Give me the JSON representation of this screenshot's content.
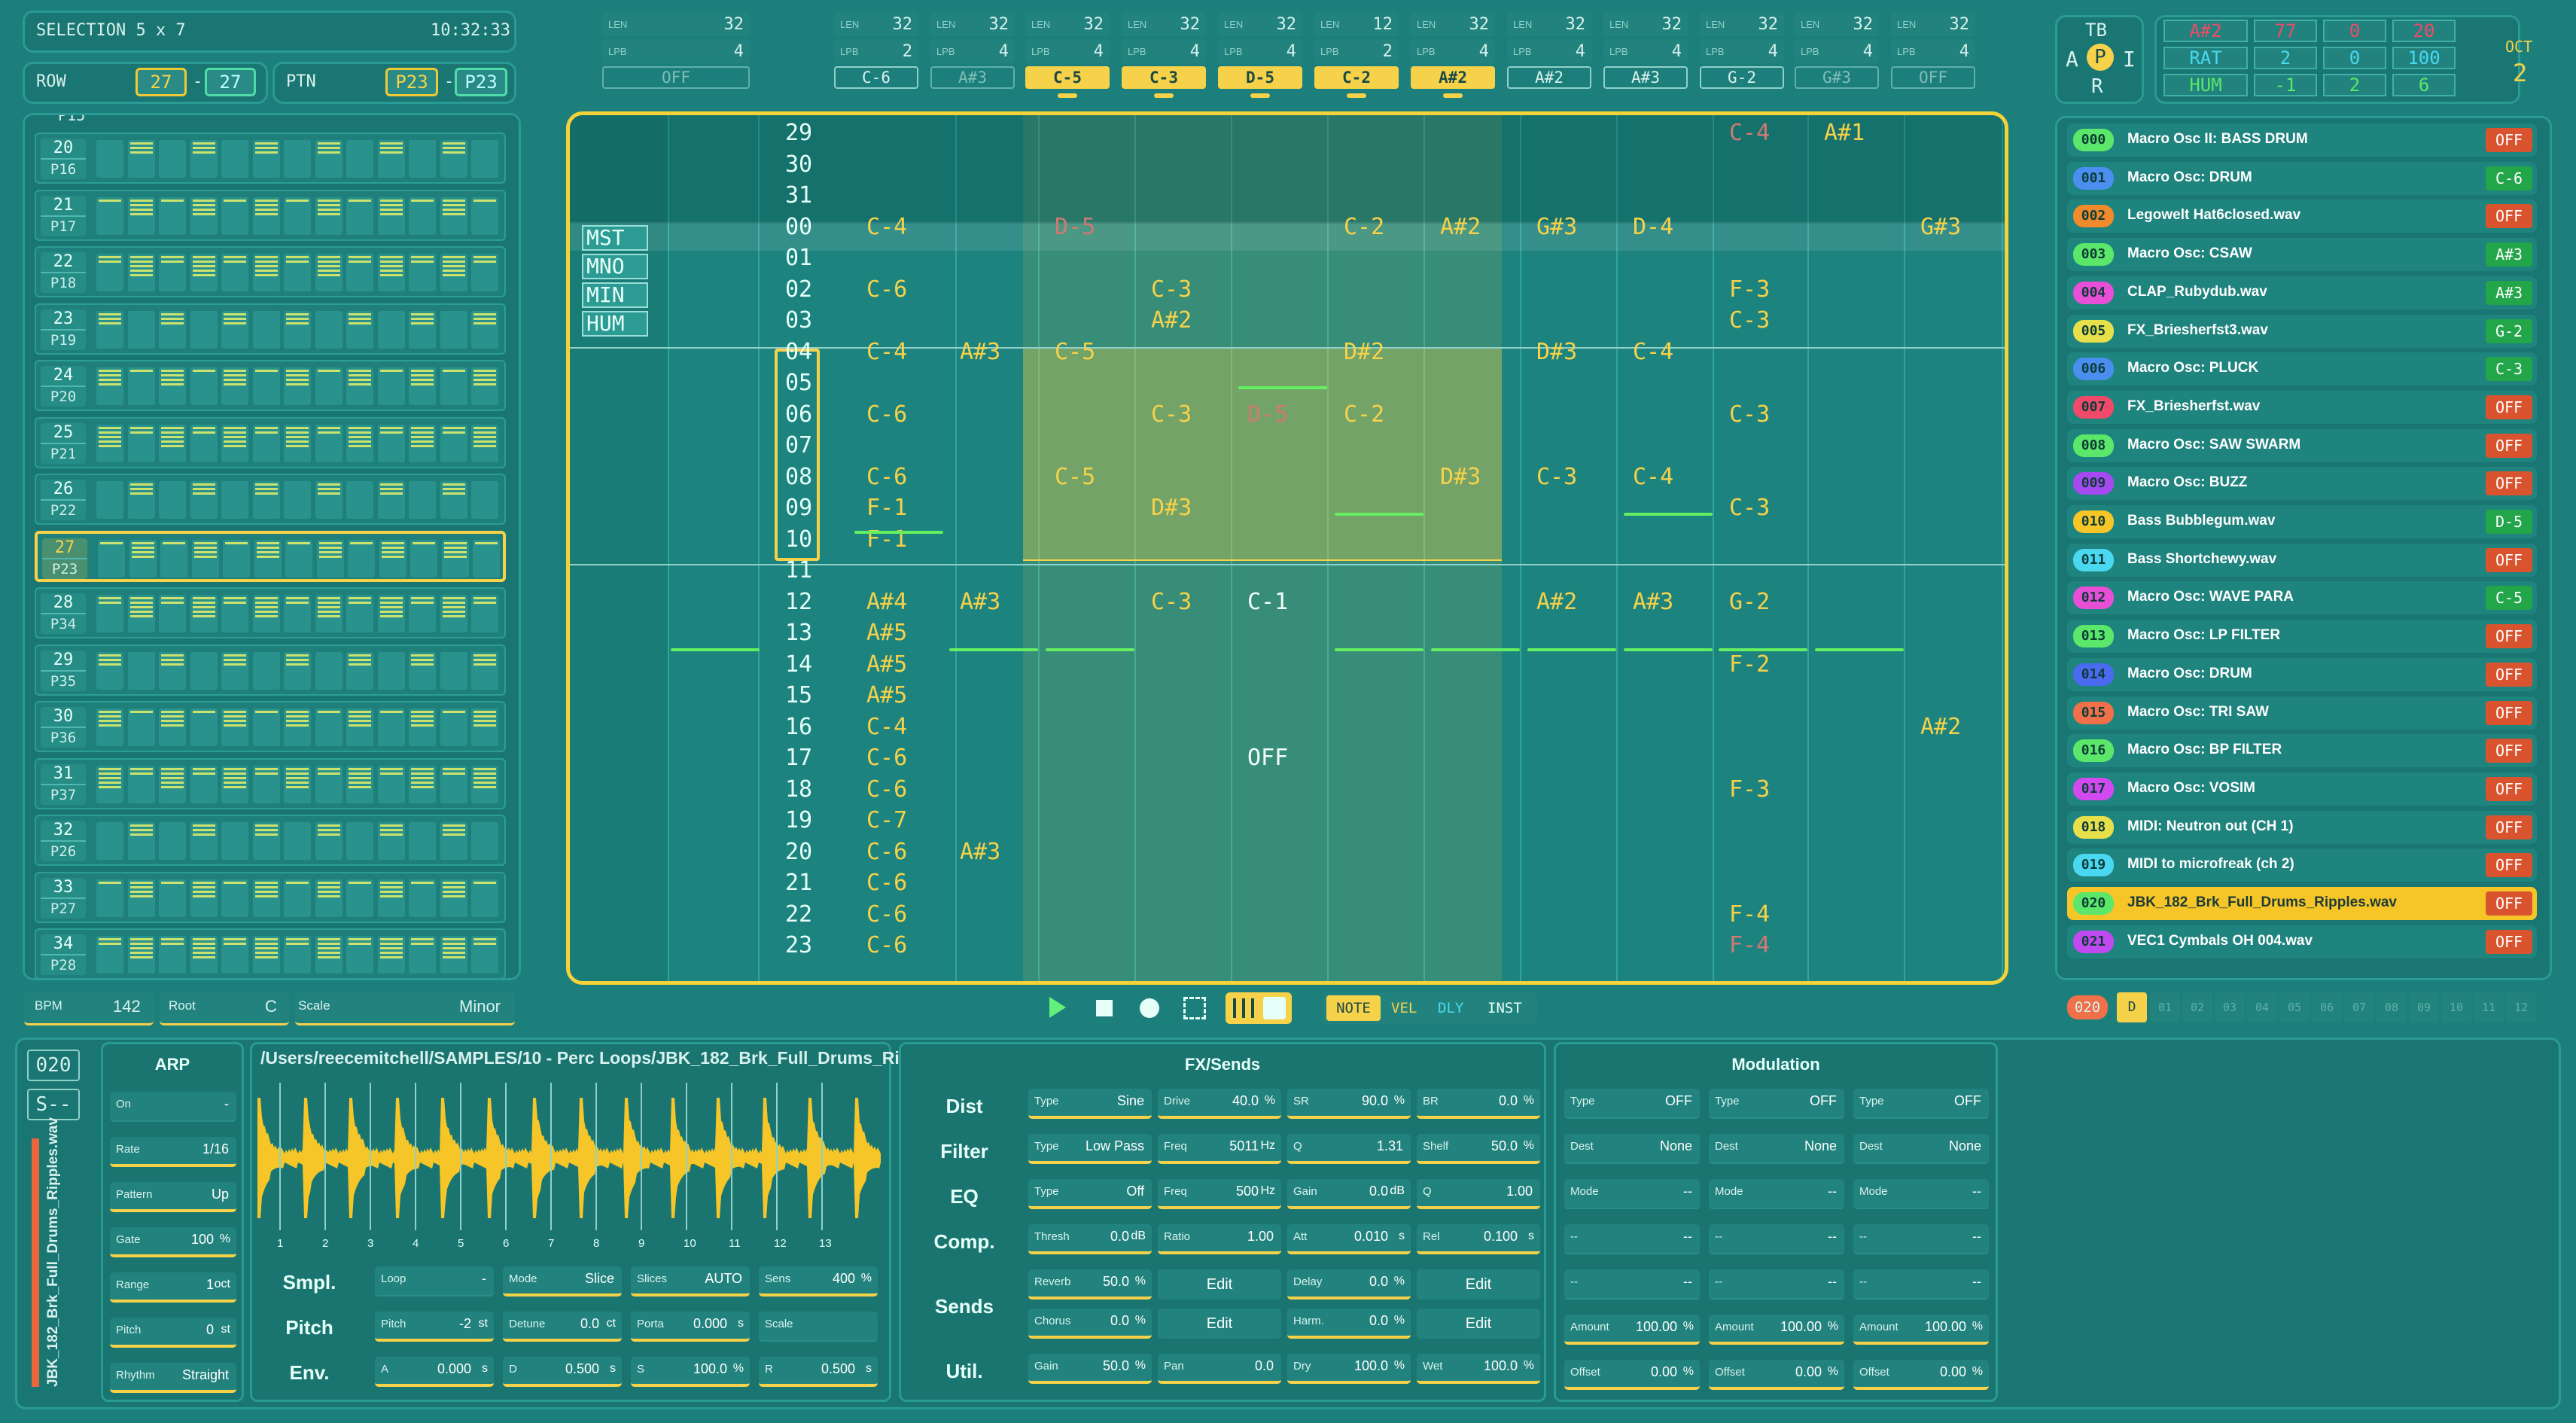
{
  "selection": "SELECTION 5 x 7",
  "clock": "10:32:33",
  "row": {
    "label": "ROW",
    "from": "27",
    "to": "27"
  },
  "ptn": {
    "label": "PTN",
    "from": "P23",
    "to": "P23"
  },
  "columns": [
    {
      "len": "32",
      "lpb": "4",
      "note": "OFF",
      "state": "off",
      "bar": false
    },
    {
      "len": "32",
      "lpb": "2",
      "note": "C-6",
      "state": "",
      "bar": false
    },
    {
      "len": "32",
      "lpb": "4",
      "note": "A#3",
      "state": "off",
      "bar": false
    },
    {
      "len": "32",
      "lpb": "4",
      "note": "C-5",
      "state": "on",
      "bar": true
    },
    {
      "len": "32",
      "lpb": "4",
      "note": "C-3",
      "state": "on",
      "bar": true
    },
    {
      "len": "32",
      "lpb": "4",
      "note": "D-5",
      "state": "on",
      "bar": true
    },
    {
      "len": "12",
      "lpb": "2",
      "note": "C-2",
      "state": "on",
      "bar": true
    },
    {
      "len": "32",
      "lpb": "4",
      "note": "A#2",
      "state": "on",
      "bar": true
    },
    {
      "len": "32",
      "lpb": "4",
      "note": "A#2",
      "state": "",
      "bar": false
    },
    {
      "len": "32",
      "lpb": "4",
      "note": "A#3",
      "state": "",
      "bar": false
    },
    {
      "len": "32",
      "lpb": "4",
      "note": "G-2",
      "state": "",
      "bar": false
    },
    {
      "len": "32",
      "lpb": "4",
      "note": "G#3",
      "state": "off",
      "bar": false
    },
    {
      "len": "32",
      "lpb": "4",
      "note": "OFF",
      "state": "off",
      "bar": false
    }
  ],
  "col_len_label": "LEN",
  "col_lpb_label": "LPB",
  "tbapir": {
    "t": "TB",
    "a": "A",
    "p": "P",
    "i": "I",
    "r": "R"
  },
  "matrix": [
    [
      "A#2",
      "77",
      "0",
      "20"
    ],
    [
      "RAT",
      "2",
      "0",
      "100"
    ],
    [
      "HUM",
      "-1",
      "2",
      "6"
    ]
  ],
  "oct": {
    "label": "OCT",
    "value": "2"
  },
  "sidebar": [
    {
      "n": "20",
      "p": "P16"
    },
    {
      "n": "21",
      "p": "P17"
    },
    {
      "n": "22",
      "p": "P18"
    },
    {
      "n": "23",
      "p": "P19"
    },
    {
      "n": "24",
      "p": "P20"
    },
    {
      "n": "25",
      "p": "P21"
    },
    {
      "n": "26",
      "p": "P22"
    },
    {
      "n": "27",
      "p": "P23"
    },
    {
      "n": "28",
      "p": "P34"
    },
    {
      "n": "29",
      "p": "P35"
    },
    {
      "n": "30",
      "p": "P36"
    },
    {
      "n": "31",
      "p": "P37"
    },
    {
      "n": "32",
      "p": "P26"
    },
    {
      "n": "33",
      "p": "P27"
    },
    {
      "n": "34",
      "p": "P28"
    }
  ],
  "sidebar_top_partial": "P15",
  "bpm": {
    "label": "BPM",
    "value": "142"
  },
  "root": {
    "label": "Root",
    "value": "C"
  },
  "scale": {
    "label": "Scale",
    "value": "Minor"
  },
  "modes": {
    "mst": "MST",
    "mno": "MNO",
    "min": "MIN",
    "hum": "HUM"
  },
  "grid_rows": [
    "29",
    "30",
    "31",
    "00",
    "01",
    "02",
    "03",
    "04",
    "05",
    "06",
    "07",
    "08",
    "09",
    "10",
    "11",
    "12",
    "13",
    "14",
    "15",
    "16",
    "17",
    "18",
    "19",
    "20",
    "21",
    "22",
    "23"
  ],
  "grid_notes": [
    {
      "r": 0,
      "c": "col10",
      "t": "C-4",
      "dim": true
    },
    {
      "r": 0,
      "c": "col11",
      "t": "A#1"
    },
    {
      "r": 3,
      "c": "col1",
      "t": "C-4"
    },
    {
      "r": 3,
      "c": "col3",
      "t": "D-5",
      "dim": true
    },
    {
      "r": 3,
      "c": "col6",
      "t": "C-2"
    },
    {
      "r": 3,
      "c": "col7",
      "t": "A#2"
    },
    {
      "r": 3,
      "c": "col8",
      "t": "G#3"
    },
    {
      "r": 3,
      "c": "col9",
      "t": "D-4"
    },
    {
      "r": 3,
      "c": "col12",
      "t": "G#3"
    },
    {
      "r": 5,
      "c": "col1",
      "t": "C-6"
    },
    {
      "r": 5,
      "c": "col4",
      "t": "C-3"
    },
    {
      "r": 5,
      "c": "col10",
      "t": "F-3"
    },
    {
      "r": 6,
      "c": "col4",
      "t": "A#2"
    },
    {
      "r": 6,
      "c": "col10",
      "t": "C-3"
    },
    {
      "r": 7,
      "c": "col1",
      "t": "C-4"
    },
    {
      "r": 7,
      "c": "col2",
      "t": "A#3"
    },
    {
      "r": 7,
      "c": "col3",
      "t": "C-5"
    },
    {
      "r": 7,
      "c": "col6",
      "t": "D#2"
    },
    {
      "r": 7,
      "c": "col8",
      "t": "D#3"
    },
    {
      "r": 7,
      "c": "col9",
      "t": "C-4"
    },
    {
      "r": 9,
      "c": "col1",
      "t": "C-6"
    },
    {
      "r": 9,
      "c": "col4",
      "t": "C-3"
    },
    {
      "r": 9,
      "c": "col5",
      "t": "D-5",
      "dim": true
    },
    {
      "r": 9,
      "c": "col6",
      "t": "C-2"
    },
    {
      "r": 9,
      "c": "col10",
      "t": "C-3"
    },
    {
      "r": 11,
      "c": "col1",
      "t": "C-6"
    },
    {
      "r": 11,
      "c": "col3",
      "t": "C-5"
    },
    {
      "r": 11,
      "c": "col7",
      "t": "D#3"
    },
    {
      "r": 11,
      "c": "col8",
      "t": "C-3"
    },
    {
      "r": 11,
      "c": "col9",
      "t": "C-4"
    },
    {
      "r": 12,
      "c": "col1",
      "t": "F-1"
    },
    {
      "r": 12,
      "c": "col4",
      "t": "D#3"
    },
    {
      "r": 12,
      "c": "col10",
      "t": "C-3"
    },
    {
      "r": 13,
      "c": "col1",
      "t": "F-1"
    },
    {
      "r": 15,
      "c": "col1",
      "t": "A#4"
    },
    {
      "r": 15,
      "c": "col2",
      "t": "A#3"
    },
    {
      "r": 15,
      "c": "col4",
      "t": "C-3"
    },
    {
      "r": 15,
      "c": "col5",
      "t": "C-1",
      "white": true
    },
    {
      "r": 15,
      "c": "col8",
      "t": "A#2"
    },
    {
      "r": 15,
      "c": "col9",
      "t": "A#3"
    },
    {
      "r": 15,
      "c": "col10",
      "t": "G-2"
    },
    {
      "r": 16,
      "c": "col1",
      "t": "A#5"
    },
    {
      "r": 17,
      "c": "col1",
      "t": "A#5"
    },
    {
      "r": 17,
      "c": "col10",
      "t": "F-2"
    },
    {
      "r": 18,
      "c": "col1",
      "t": "A#5"
    },
    {
      "r": 19,
      "c": "col1",
      "t": "C-4"
    },
    {
      "r": 19,
      "c": "col12",
      "t": "A#2"
    },
    {
      "r": 20,
      "c": "col1",
      "t": "C-6"
    },
    {
      "r": 20,
      "c": "col5",
      "t": "OFF",
      "white": true
    },
    {
      "r": 21,
      "c": "col1",
      "t": "C-6"
    },
    {
      "r": 21,
      "c": "col10",
      "t": "F-3"
    },
    {
      "r": 22,
      "c": "col1",
      "t": "C-7"
    },
    {
      "r": 23,
      "c": "col1",
      "t": "C-6"
    },
    {
      "r": 23,
      "c": "col2",
      "t": "A#3"
    },
    {
      "r": 24,
      "c": "col1",
      "t": "C-6"
    },
    {
      "r": 25,
      "c": "col1",
      "t": "C-6"
    },
    {
      "r": 25,
      "c": "col10",
      "t": "F-4"
    },
    {
      "r": 26,
      "c": "col1",
      "t": "C-6"
    },
    {
      "r": 26,
      "c": "col10",
      "t": "F-4",
      "dim": true
    }
  ],
  "transport": {
    "note": "NOTE",
    "vel": "VEL",
    "dly": "DLY",
    "inst": "INST"
  },
  "instruments": [
    {
      "id": "000",
      "name": "Macro Osc II: BASS DRUM",
      "st": "OFF",
      "c": "#5be86a"
    },
    {
      "id": "001",
      "name": "Macro Osc: DRUM",
      "st": "C-6",
      "c": "#4a8ff0"
    },
    {
      "id": "002",
      "name": "Legowelt Hat6closed.wav",
      "st": "OFF",
      "c": "#f08a2a"
    },
    {
      "id": "003",
      "name": "Macro Osc: CSAW",
      "st": "A#3",
      "c": "#5be86a"
    },
    {
      "id": "004",
      "name": "CLAP_Rubydub.wav",
      "st": "A#3",
      "c": "#e64fd6"
    },
    {
      "id": "005",
      "name": "FX_Briesherfst3.wav",
      "st": "G-2",
      "c": "#e8e04a"
    },
    {
      "id": "006",
      "name": "Macro Osc: PLUCK",
      "st": "C-3",
      "c": "#4a8ff0"
    },
    {
      "id": "007",
      "name": "FX_Briesherfst.wav",
      "st": "OFF",
      "c": "#f04a6a"
    },
    {
      "id": "008",
      "name": "Macro Osc: SAW SWARM",
      "st": "OFF",
      "c": "#5be86a"
    },
    {
      "id": "009",
      "name": "Macro Osc: BUZZ",
      "st": "OFF",
      "c": "#a44af0"
    },
    {
      "id": "010",
      "name": "Bass Bubblegum.wav",
      "st": "D-5",
      "c": "#f6c629"
    },
    {
      "id": "011",
      "name": "Bass Shortchewy.wav",
      "st": "OFF",
      "c": "#4ad8f0"
    },
    {
      "id": "012",
      "name": "Macro Osc: WAVE PARA",
      "st": "C-5",
      "c": "#e64fd6"
    },
    {
      "id": "013",
      "name": "Macro Osc: LP FILTER",
      "st": "OFF",
      "c": "#5be86a"
    },
    {
      "id": "014",
      "name": "Macro Osc: DRUM",
      "st": "OFF",
      "c": "#4a6af0"
    },
    {
      "id": "015",
      "name": "Macro Osc: TRI SAW",
      "st": "OFF",
      "c": "#f0704a"
    },
    {
      "id": "016",
      "name": "Macro Osc: BP FILTER",
      "st": "OFF",
      "c": "#5be86a"
    },
    {
      "id": "017",
      "name": "Macro Osc: VOSIM",
      "st": "OFF",
      "c": "#d04af0"
    },
    {
      "id": "018",
      "name": "MIDI: Neutron out (CH 1)",
      "st": "OFF",
      "c": "#e8e04a"
    },
    {
      "id": "019",
      "name": "MIDI to microfreak (ch 2)",
      "st": "OFF",
      "c": "#4ad8f0"
    },
    {
      "id": "020",
      "name": "JBK_182_Brk_Full_Drums_Ripples.wav",
      "st": "OFF",
      "c": "#5be86a"
    },
    {
      "id": "021",
      "name": "VEC1 Cymbals  OH 004.wav",
      "st": "OFF",
      "c": "#c04af0"
    }
  ],
  "inst_sel": "020",
  "inst_tab": "D",
  "inst_tabs": [
    "01",
    "02",
    "03",
    "04",
    "05",
    "06",
    "07",
    "08",
    "09",
    "10",
    "11",
    "12"
  ],
  "left_box": {
    "id": "020",
    "s": "S--",
    "file": "JBK_182_Brk_Full_Drums_Ripples.wav"
  },
  "arp": {
    "title": "ARP",
    "rows": [
      [
        "On",
        "-"
      ],
      [
        "Rate",
        "1/16"
      ],
      [
        "Pattern",
        "Up"
      ],
      [
        "Gate",
        "100",
        "%"
      ],
      [
        "Range",
        "1",
        "oct"
      ],
      [
        "Pitch",
        "0",
        "st"
      ],
      [
        "Rhythm",
        "Straight"
      ]
    ]
  },
  "sample_path": "/Users/reecemitchell/SAMPLES/10 - Perc Loops/JBK_182_Brk_Full_Drums_Rip...",
  "wave_marks": [
    "1",
    "2",
    "3",
    "4",
    "5",
    "6",
    "7",
    "8",
    "9",
    "10",
    "11",
    "12",
    "13"
  ],
  "smpl": {
    "label": "Smpl.",
    "f": [
      [
        "Loop",
        "-"
      ],
      [
        "Mode",
        "Slice"
      ],
      [
        "Slices",
        "AUTO"
      ],
      [
        "Sens",
        "400",
        "%"
      ]
    ]
  },
  "pitch": {
    "label": "Pitch",
    "f": [
      [
        "Pitch",
        "-2",
        "st"
      ],
      [
        "Detune",
        "0.0",
        "ct"
      ],
      [
        "Porta",
        "0.000",
        "s"
      ],
      [
        "Scale",
        ""
      ]
    ]
  },
  "env": {
    "label": "Env.",
    "f": [
      [
        "A",
        "0.000",
        "s"
      ],
      [
        "D",
        "0.500",
        "s"
      ],
      [
        "S",
        "100.0",
        "%"
      ],
      [
        "R",
        "0.500",
        "s"
      ]
    ]
  },
  "fx": {
    "title": "FX/Sends",
    "rows": [
      {
        "label": "Dist",
        "f": [
          [
            "Type",
            "Sine",
            ""
          ],
          [
            "Drive",
            "40.0",
            "%"
          ],
          [
            "SR",
            "90.0",
            "%"
          ],
          [
            "BR",
            "0.0",
            "%"
          ]
        ]
      },
      {
        "label": "Filter",
        "f": [
          [
            "Type",
            "Low Pass",
            ""
          ],
          [
            "Freq",
            "5011",
            "Hz"
          ],
          [
            "Q",
            "1.31",
            ""
          ],
          [
            "Shelf",
            "50.0",
            "%"
          ]
        ]
      },
      {
        "label": "EQ",
        "f": [
          [
            "Type",
            "Off",
            ""
          ],
          [
            "Freq",
            "500",
            "Hz"
          ],
          [
            "Gain",
            "0.0",
            "dB"
          ],
          [
            "Q",
            "1.00",
            ""
          ]
        ]
      },
      {
        "label": "Comp.",
        "f": [
          [
            "Thresh",
            "0.0",
            "dB"
          ],
          [
            "Ratio",
            "1.00",
            ""
          ],
          [
            "Att",
            "0.010",
            "s"
          ],
          [
            "Rel",
            "0.100",
            "s"
          ]
        ]
      }
    ],
    "sends_label": "Sends",
    "reverb": [
      "Reverb",
      "50.0",
      "%"
    ],
    "chorus": [
      "Chorus",
      "0.0",
      "%"
    ],
    "delay": [
      "Delay",
      "0.0",
      "%"
    ],
    "harm": [
      "Harm.",
      "0.0",
      "%"
    ],
    "edit": "Edit",
    "util_label": "Util.",
    "util": [
      [
        "Gain",
        "50.0",
        "%"
      ],
      [
        "Pan",
        "0.0",
        ""
      ],
      [
        "Dry",
        "100.0",
        "%"
      ],
      [
        "Wet",
        "100.0",
        "%"
      ]
    ]
  },
  "mod": {
    "title": "Modulation",
    "cols": [
      [
        [
          "Type",
          "OFF",
          ""
        ],
        [
          "Dest",
          "None",
          ""
        ],
        [
          "Mode",
          "--",
          ""
        ],
        [
          "--",
          "--",
          ""
        ],
        [
          "--",
          "--",
          ""
        ],
        [
          "Amount",
          "100.00",
          "%"
        ],
        [
          "Offset",
          "0.00",
          "%"
        ]
      ],
      [
        [
          "Type",
          "OFF",
          ""
        ],
        [
          "Dest",
          "None",
          ""
        ],
        [
          "Mode",
          "--",
          ""
        ],
        [
          "--",
          "--",
          ""
        ],
        [
          "--",
          "--",
          ""
        ],
        [
          "Amount",
          "100.00",
          "%"
        ],
        [
          "Offset",
          "0.00",
          "%"
        ]
      ],
      [
        [
          "Type",
          "OFF",
          ""
        ],
        [
          "Dest",
          "None",
          ""
        ],
        [
          "Mode",
          "--",
          ""
        ],
        [
          "--",
          "--",
          ""
        ],
        [
          "--",
          "--",
          ""
        ],
        [
          "Amount",
          "100.00",
          "%"
        ],
        [
          "Offset",
          "0.00",
          "%"
        ]
      ]
    ]
  }
}
